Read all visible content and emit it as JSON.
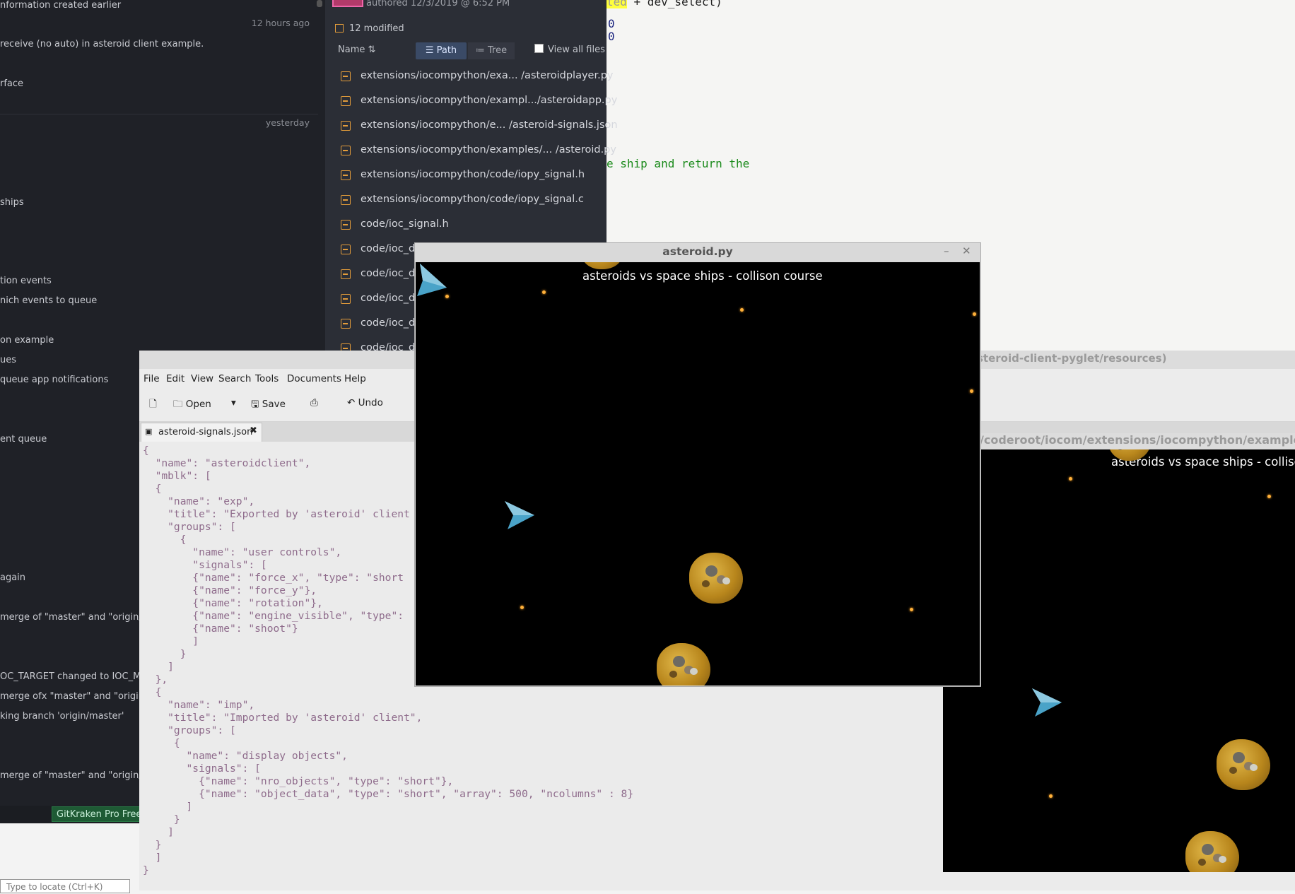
{
  "bg_editor": {
    "lines": [
      {
        "pre": "ted",
        "post": " + dev_select)"
      },
      {
        "navy": "0"
      },
      {
        "navy": "0"
      },
      {
        "green": "e ship and return the"
      }
    ]
  },
  "gk_left": {
    "items": [
      "nformation created earlier",
      "receive (no auto) in asteroid client example.",
      "rface",
      "ships",
      "tion events",
      "nich events to queue",
      "on example",
      "ues",
      "queue app notifications",
      "ent queue",
      "again",
      "merge of \"master\" and \"origin/mast",
      "OC_TARGET changed to IOC_MBLK_",
      "merge ofx \"master\" and \"origin/mas",
      "king branch 'origin/master'",
      "merge of \"master\" and \"origin/mast"
    ],
    "timestamps": [
      "12 hours ago",
      "yesterday"
    ],
    "trial": "GitKraken Pro Free T",
    "locate_placeholder": "Type to locate (Ctrl+K)"
  },
  "gk_files": {
    "author": "authored 12/3/2019 @ 6:52 PM",
    "modified": "12 modified",
    "name_col": "Name",
    "path_tab": "Path",
    "tree_tab": "Tree",
    "view_all": "View all files",
    "files": [
      "extensions/iocompython/exa...  /asteroidplayer.py",
      "extensions/iocompython/exampl.../asteroidapp.py",
      "extensions/iocompython/e...  /asteroid-signals.json",
      "extensions/iocompython/examples/...  /asteroid.py",
      "extensions/iocompython/code/iopy_signal.h",
      "extensions/iocompython/code/iopy_signal.c",
      "code/ioc_signal.h",
      "code/ioc_dyn",
      "code/ioc_dyn",
      "code/ioc_dyn",
      "code/ioc_dyn",
      "code/ioc_dyn"
    ]
  },
  "gedit": {
    "title_right": "steroid-client-pyglet/resources)",
    "menu": [
      "File",
      "Edit",
      "View",
      "Search",
      "Tools",
      "Documents",
      "Help"
    ],
    "toolbar": {
      "open": "Open",
      "save": "Save",
      "undo": "Undo"
    },
    "tab": "asteroid-signals.json",
    "lines": [
      "{",
      "  \"name\": \"asteroidclient\",",
      "  \"mblk\": [",
      "  {",
      "    \"name\": \"exp\",",
      "    \"title\": \"Exported by 'asteroid' client",
      "    \"groups\": [",
      "      {",
      "        \"name\": \"user controls\",",
      "        \"signals\": [",
      "        {\"name\": \"force_x\", \"type\": \"short",
      "        {\"name\": \"force_y\"},",
      "        {\"name\": \"rotation\"},",
      "        {\"name\": \"engine_visible\", \"type\":",
      "        {\"name\": \"shoot\"}",
      "        ]",
      "      }",
      "    ]",
      "  },",
      "  {",
      "    \"name\": \"imp\",",
      "    \"title\": \"Imported by 'asteroid' client\",",
      "    \"groups\": [",
      "     {",
      "       \"name\": \"display objects\",",
      "       \"signals\": [",
      "         {\"name\": \"nro_objects\", \"type\": \"short\"},",
      "         {\"name\": \"object_data\", \"type\": \"short\", \"array\": 500, \"ncolumns\" : 8}",
      "       ]",
      "     }",
      "    ]",
      "  }",
      "  ]",
      "}"
    ]
  },
  "asteroid_main": {
    "window_title": "asteroid.py",
    "game_title": "asteroids vs space ships - collison course"
  },
  "asteroid_second": {
    "window_title": "/coderoot/iocom/extensions/iocompython/examples/ast",
    "game_title": "asteroids vs space ships - collisor"
  },
  "colors": {
    "star": "#ffb13b",
    "ship": "#4aa3c8",
    "gk_bg": "#1f2127",
    "file_icon": "#e39c3a"
  }
}
